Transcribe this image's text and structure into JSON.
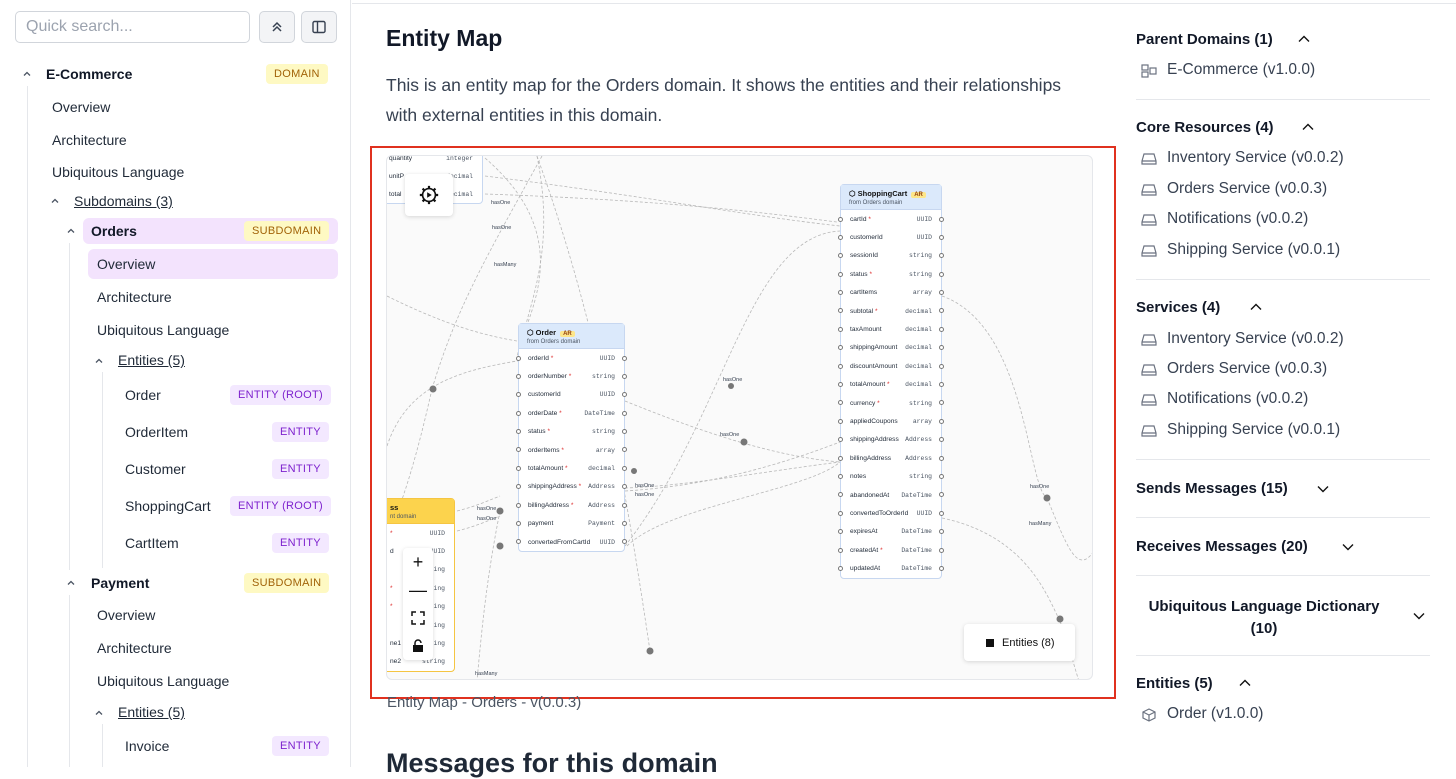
{
  "sidebar": {
    "search_placeholder": "Quick search...",
    "items": [
      {
        "label": "E-Commerce",
        "badge": "DOMAIN"
      },
      {
        "label": "Overview"
      },
      {
        "label": "Architecture"
      },
      {
        "label": "Ubiquitous Language"
      },
      {
        "label": "Subdomains (3)"
      },
      {
        "label": "Orders",
        "badge": "SUBDOMAIN"
      },
      {
        "label": "Overview"
      },
      {
        "label": "Architecture"
      },
      {
        "label": "Ubiquitous Language"
      },
      {
        "label": "Entities (5)"
      },
      {
        "label": "Order",
        "badge": "ENTITY (ROOT)"
      },
      {
        "label": "OrderItem",
        "badge": "ENTITY"
      },
      {
        "label": "Customer",
        "badge": "ENTITY"
      },
      {
        "label": "ShoppingCart",
        "badge": "ENTITY (ROOT)"
      },
      {
        "label": "CartItem",
        "badge": "ENTITY"
      },
      {
        "label": "Payment",
        "badge": "SUBDOMAIN"
      },
      {
        "label": "Overview"
      },
      {
        "label": "Architecture"
      },
      {
        "label": "Ubiquitous Language"
      },
      {
        "label": "Entities (5)"
      },
      {
        "label": "Invoice",
        "badge": "ENTITY"
      }
    ]
  },
  "main": {
    "title": "Entity Map",
    "description": "This is an entity map for the Orders domain. It shows the entities and their relationships with external entities in this domain.",
    "caption": "Entity Map - Orders - v(0.0.3)",
    "next_heading": "Messages for this domain",
    "map": {
      "legend": "Entities (8)",
      "partial_top_rows": [
        {
          "name": "quantity",
          "type": "integer"
        },
        {
          "name": "unitP",
          "type": "decimal"
        },
        {
          "name": "total",
          "type": "decimal"
        }
      ],
      "order": {
        "title": "Order",
        "tag": "AR",
        "subtitle": "from Orders domain",
        "fields": [
          {
            "name": "orderId",
            "req": "*",
            "type": "UUID"
          },
          {
            "name": "orderNumber",
            "req": "*",
            "type": "string"
          },
          {
            "name": "customerId",
            "req": "",
            "type": "UUID"
          },
          {
            "name": "orderDate",
            "req": "*",
            "type": "DateTime"
          },
          {
            "name": "status",
            "req": "*",
            "type": "string"
          },
          {
            "name": "orderItems",
            "req": "*",
            "type": "array"
          },
          {
            "name": "totalAmount",
            "req": "*",
            "type": "decimal"
          },
          {
            "name": "shippingAddress",
            "req": "*",
            "type": "Address"
          },
          {
            "name": "billingAddress",
            "req": "*",
            "type": "Address"
          },
          {
            "name": "payment",
            "req": "",
            "type": "Payment"
          },
          {
            "name": "convertedFromCartId",
            "req": "",
            "type": "UUID"
          }
        ]
      },
      "cart": {
        "title": "ShoppingCart",
        "tag": "AR",
        "subtitle": "from Orders domain",
        "fields": [
          {
            "name": "cartId",
            "req": "*",
            "type": "UUID"
          },
          {
            "name": "customerId",
            "req": "",
            "type": "UUID"
          },
          {
            "name": "sessionId",
            "req": "",
            "type": "string"
          },
          {
            "name": "status",
            "req": "*",
            "type": "string"
          },
          {
            "name": "cartItems",
            "req": "",
            "type": "array"
          },
          {
            "name": "subtotal",
            "req": "*",
            "type": "decimal"
          },
          {
            "name": "taxAmount",
            "req": "",
            "type": "decimal"
          },
          {
            "name": "shippingAmount",
            "req": "",
            "type": "decimal"
          },
          {
            "name": "discountAmount",
            "req": "",
            "type": "decimal"
          },
          {
            "name": "totalAmount",
            "req": "*",
            "type": "decimal"
          },
          {
            "name": "currency",
            "req": "*",
            "type": "string"
          },
          {
            "name": "appliedCoupons",
            "req": "",
            "type": "array"
          },
          {
            "name": "shippingAddress",
            "req": "",
            "type": "Address"
          },
          {
            "name": "billingAddress",
            "req": "",
            "type": "Address"
          },
          {
            "name": "notes",
            "req": "",
            "type": "string"
          },
          {
            "name": "abandonedAt",
            "req": "",
            "type": "DateTime"
          },
          {
            "name": "convertedToOrderId",
            "req": "",
            "type": "UUID"
          },
          {
            "name": "expiresAt",
            "req": "",
            "type": "DateTime"
          },
          {
            "name": "createdAt",
            "req": "*",
            "type": "DateTime"
          },
          {
            "name": "updatedAt",
            "req": "",
            "type": "DateTime"
          }
        ]
      },
      "yellow_node": {
        "title": "ss",
        "subtitle": "nt domain",
        "fields": [
          {
            "name": "",
            "req": "*",
            "type": "UUID"
          },
          {
            "name": "d",
            "req": "",
            "type": "UUID"
          },
          {
            "name": "",
            "req": "",
            "type": "ing"
          },
          {
            "name": "",
            "req": "*",
            "type": "ing"
          },
          {
            "name": "",
            "req": "*",
            "type": "ing"
          },
          {
            "name": "",
            "req": "",
            "type": "ing"
          },
          {
            "name": "ne1",
            "req": "*",
            "type": "ing"
          },
          {
            "name": "ne2",
            "req": "",
            "type": "string"
          }
        ]
      },
      "edge_labels": [
        "hasOne",
        "hasOne",
        "hasMany",
        "hasOne",
        "hasOne",
        "hasOne",
        "hasOne",
        "hasOne",
        "hasOne",
        "hasOne",
        "hasMany",
        "hasMany"
      ]
    }
  },
  "right": {
    "parent_domains": {
      "title": "Parent Domains (1)",
      "items": [
        "E-Commerce (v1.0.0)"
      ]
    },
    "core_resources": {
      "title": "Core Resources (4)",
      "items": [
        "Inventory Service (v0.0.2)",
        "Orders Service (v0.0.3)",
        "Notifications (v0.0.2)",
        "Shipping Service (v0.0.1)"
      ]
    },
    "services": {
      "title": "Services (4)",
      "items": [
        "Inventory Service (v0.0.2)",
        "Orders Service (v0.0.3)",
        "Notifications (v0.0.2)",
        "Shipping Service (v0.0.1)"
      ]
    },
    "sends": {
      "title": "Sends Messages (15)"
    },
    "receives": {
      "title": "Receives Messages (20)"
    },
    "dictionary": {
      "title_line1": "Ubiquitous Language Dictionary",
      "title_line2": "(10)"
    },
    "entities": {
      "title": "Entities (5)",
      "items": [
        "Order (v1.0.0)"
      ]
    }
  },
  "colors": {
    "accent_highlight": "#f3e3fd",
    "badge_domain_bg": "#fef9c3",
    "badge_entity_bg": "#f3e8ff",
    "selection_frame": "#e0311f",
    "node_header": "#dbe9fb",
    "node_header_external": "#fcd34d"
  }
}
